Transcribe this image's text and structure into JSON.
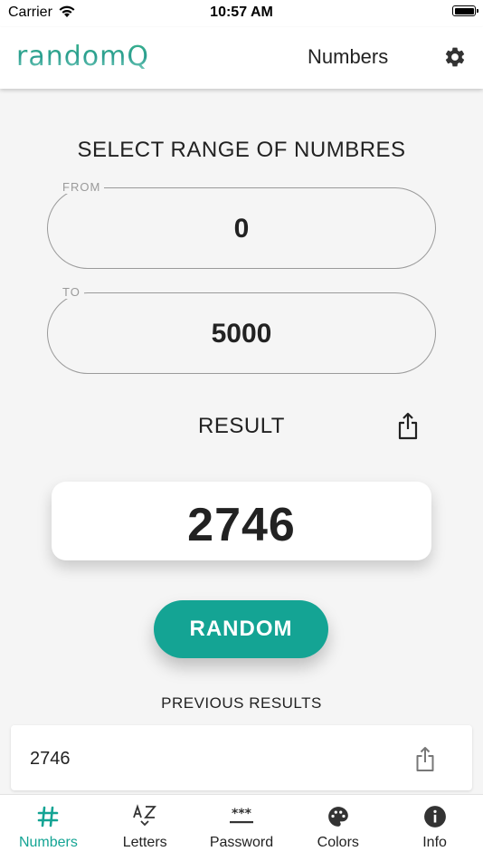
{
  "status_bar": {
    "carrier": "Carrier",
    "time": "10:57 AM"
  },
  "app_bar": {
    "logo_text": "randomQ",
    "title": "Numbers"
  },
  "range": {
    "title": "SELECT RANGE OF NUMBRES",
    "from_label": "FROM",
    "from_value": "0",
    "to_label": "TO",
    "to_value": "5000"
  },
  "result": {
    "label": "RESULT",
    "value": "2746"
  },
  "random_button": {
    "label": "RANDOM"
  },
  "previous": {
    "title": "PREVIOUS RESULTS",
    "items": [
      {
        "value": "2746"
      }
    ]
  },
  "tabs": [
    {
      "label": "Numbers",
      "icon": "hash-icon",
      "active": true
    },
    {
      "label": "Letters",
      "icon": "az-sort-icon",
      "active": false
    },
    {
      "label": "Password",
      "icon": "password-icon",
      "active": false
    },
    {
      "label": "Colors",
      "icon": "palette-icon",
      "active": false
    },
    {
      "label": "Info",
      "icon": "info-icon",
      "active": false
    }
  ],
  "colors": {
    "accent": "#14a494",
    "background": "#f5f5f5"
  }
}
